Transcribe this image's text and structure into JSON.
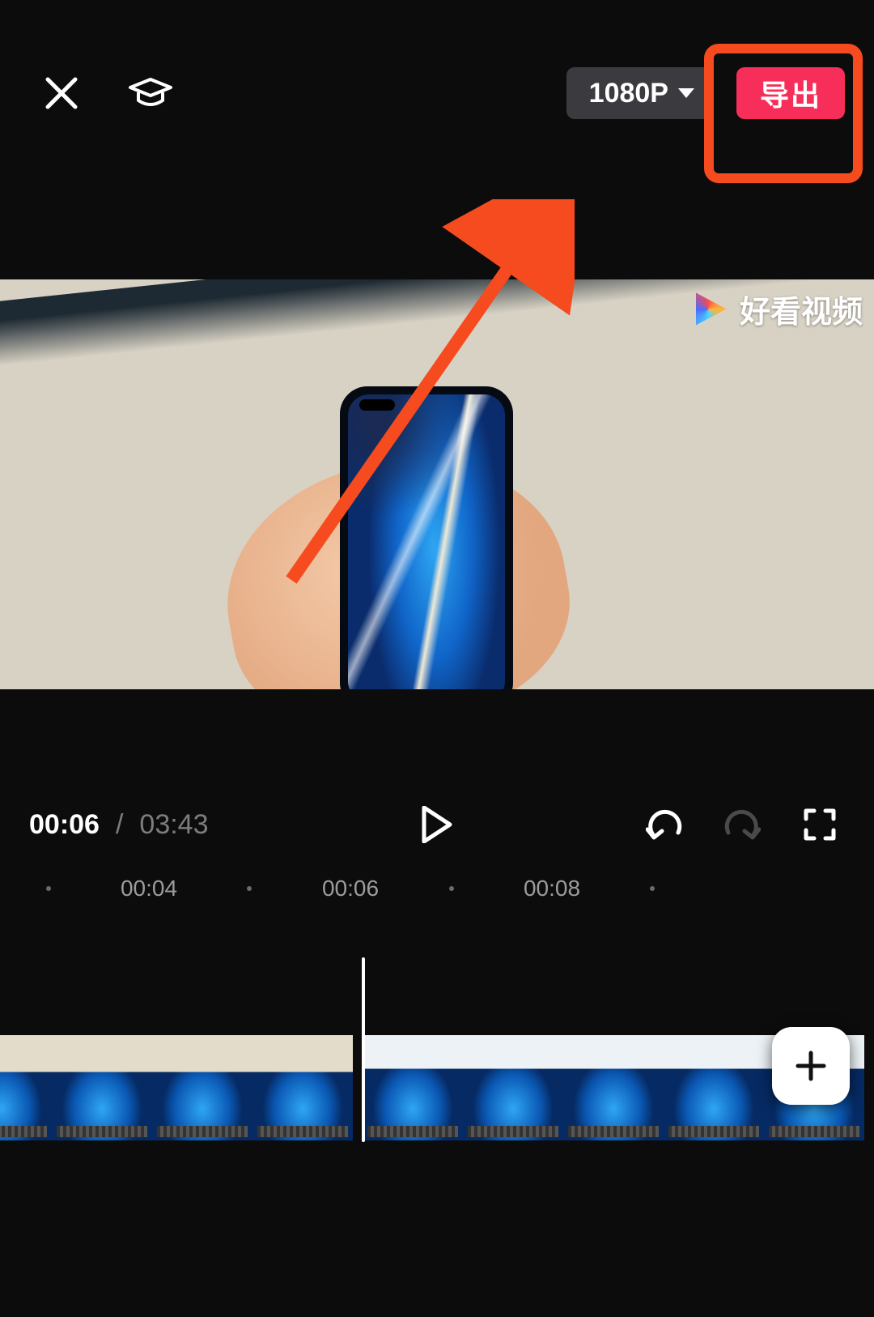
{
  "status": {
    "time": ""
  },
  "topbar": {
    "resolution_label": "1080P",
    "export_label": "导出"
  },
  "watermark": {
    "text": "好看视频"
  },
  "playback": {
    "current_time": "00:06",
    "separator": "/",
    "total_time": "03:43"
  },
  "ruler": {
    "marks": [
      {
        "pos": 60,
        "label": "",
        "dot": true
      },
      {
        "pos": 184,
        "label": "00:04",
        "dot": false
      },
      {
        "pos": 308,
        "label": "",
        "dot": true
      },
      {
        "pos": 433,
        "label": "00:06",
        "dot": false
      },
      {
        "pos": 558,
        "label": "",
        "dot": true
      },
      {
        "pos": 682,
        "label": "00:08",
        "dot": false
      },
      {
        "pos": 806,
        "label": "",
        "dot": true
      }
    ]
  },
  "icons": {
    "close": "close-icon",
    "tutorial": "graduation-cap-icon",
    "play": "play-icon",
    "undo": "undo-icon",
    "redo": "redo-icon",
    "fullscreen": "fullscreen-icon",
    "add": "plus-icon"
  }
}
